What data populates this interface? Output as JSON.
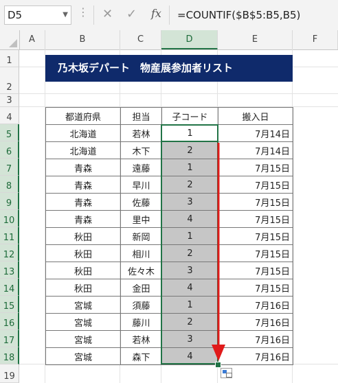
{
  "formula_bar": {
    "name_box": "D5",
    "cancel_icon": "✕",
    "enter_icon": "✓",
    "fx_label": "fx",
    "formula": "=COUNTIF($B$5:B5,B5)"
  },
  "columns": [
    "A",
    "B",
    "C",
    "D",
    "E",
    "F"
  ],
  "rows": [
    "1",
    "2",
    "3",
    "4",
    "5",
    "6",
    "7",
    "8",
    "9",
    "10",
    "11",
    "12",
    "13",
    "14",
    "15",
    "16",
    "17",
    "18",
    "19"
  ],
  "title": "乃木坂デパート　物産展参加者リスト",
  "table": {
    "headers": [
      "都道府県",
      "担当",
      "子コード",
      "搬入日"
    ],
    "rows": [
      [
        "北海道",
        "若林",
        "1",
        "7月14日"
      ],
      [
        "北海道",
        "木下",
        "2",
        "7月14日"
      ],
      [
        "青森",
        "遠藤",
        "1",
        "7月15日"
      ],
      [
        "青森",
        "早川",
        "2",
        "7月15日"
      ],
      [
        "青森",
        "佐藤",
        "3",
        "7月15日"
      ],
      [
        "青森",
        "里中",
        "4",
        "7月15日"
      ],
      [
        "秋田",
        "新岡",
        "1",
        "7月15日"
      ],
      [
        "秋田",
        "相川",
        "2",
        "7月15日"
      ],
      [
        "秋田",
        "佐々木",
        "3",
        "7月15日"
      ],
      [
        "秋田",
        "金田",
        "4",
        "7月15日"
      ],
      [
        "宮城",
        "須藤",
        "1",
        "7月16日"
      ],
      [
        "宮城",
        "藤川",
        "2",
        "7月16日"
      ],
      [
        "宮城",
        "若林",
        "3",
        "7月16日"
      ],
      [
        "宮城",
        "森下",
        "4",
        "7月16日"
      ]
    ]
  },
  "colors": {
    "title_bg": "#0f2a6b",
    "selection": "#217346",
    "fill_gray": "#c6c6c6",
    "arrow": "#e01a1a"
  }
}
